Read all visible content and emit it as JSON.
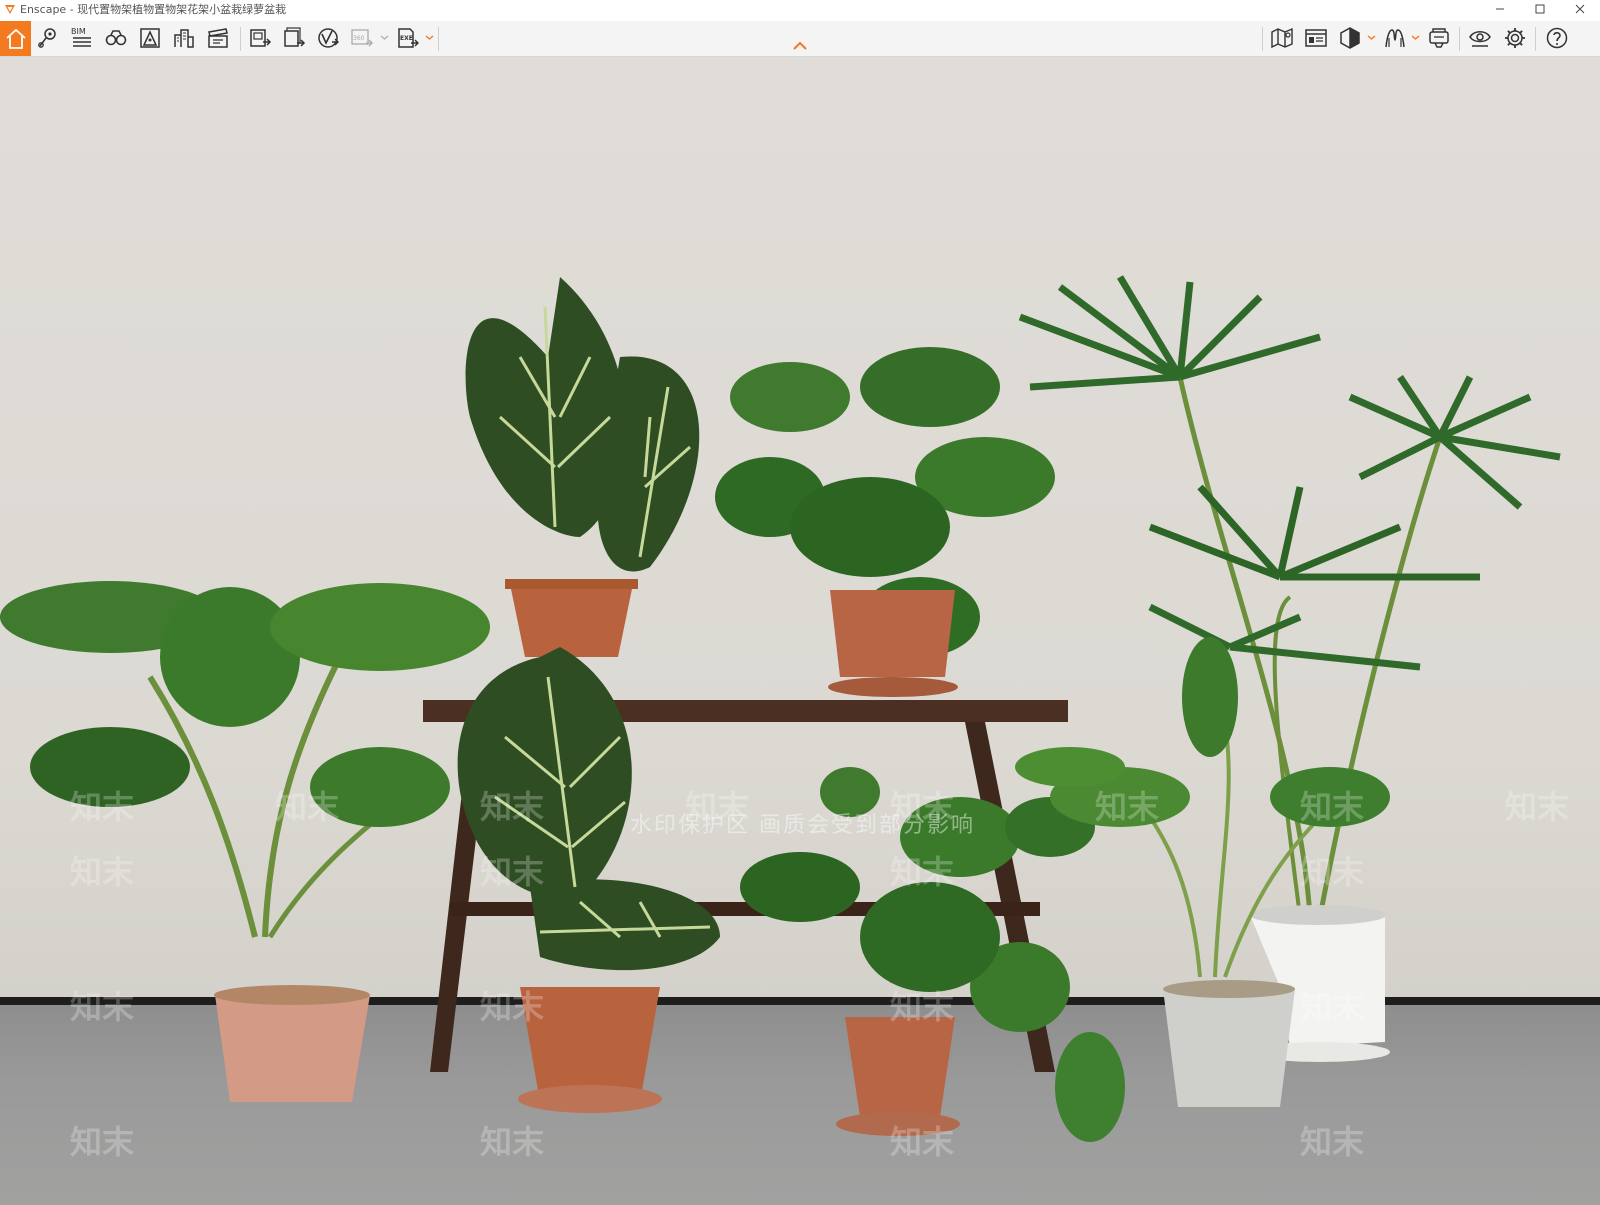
{
  "window": {
    "title": "Enscape - 现代置物架植物置物架花架小盆栽绿萝盆栽",
    "controls": [
      "minimize-icon",
      "maximize-icon",
      "close-icon"
    ]
  },
  "toolbar": {
    "left_buttons": [
      "home-icon",
      "location-pin-icon",
      "bim-icon",
      "binoculars-icon",
      "site-context-icon",
      "buildings-icon",
      "video-clapper-icon",
      "render-image-icon",
      "batch-render-icon",
      "vr-web-icon",
      "panorama-360-icon",
      "export-exe-icon"
    ],
    "bim_label": "BIM",
    "panorama_label": "360",
    "exe_label": "EXE",
    "right_buttons": [
      "map-icon",
      "asset-library-icon",
      "visual-settings-cube-icon",
      "material-editor-icon",
      "vr-headset-icon",
      "view-eye-icon",
      "settings-gear-icon",
      "help-icon"
    ],
    "accent_color": "#f47a20"
  },
  "viewport": {
    "watermark_banner": "水印保护区  画质会受到部分影响",
    "watermark_text": "知末"
  }
}
